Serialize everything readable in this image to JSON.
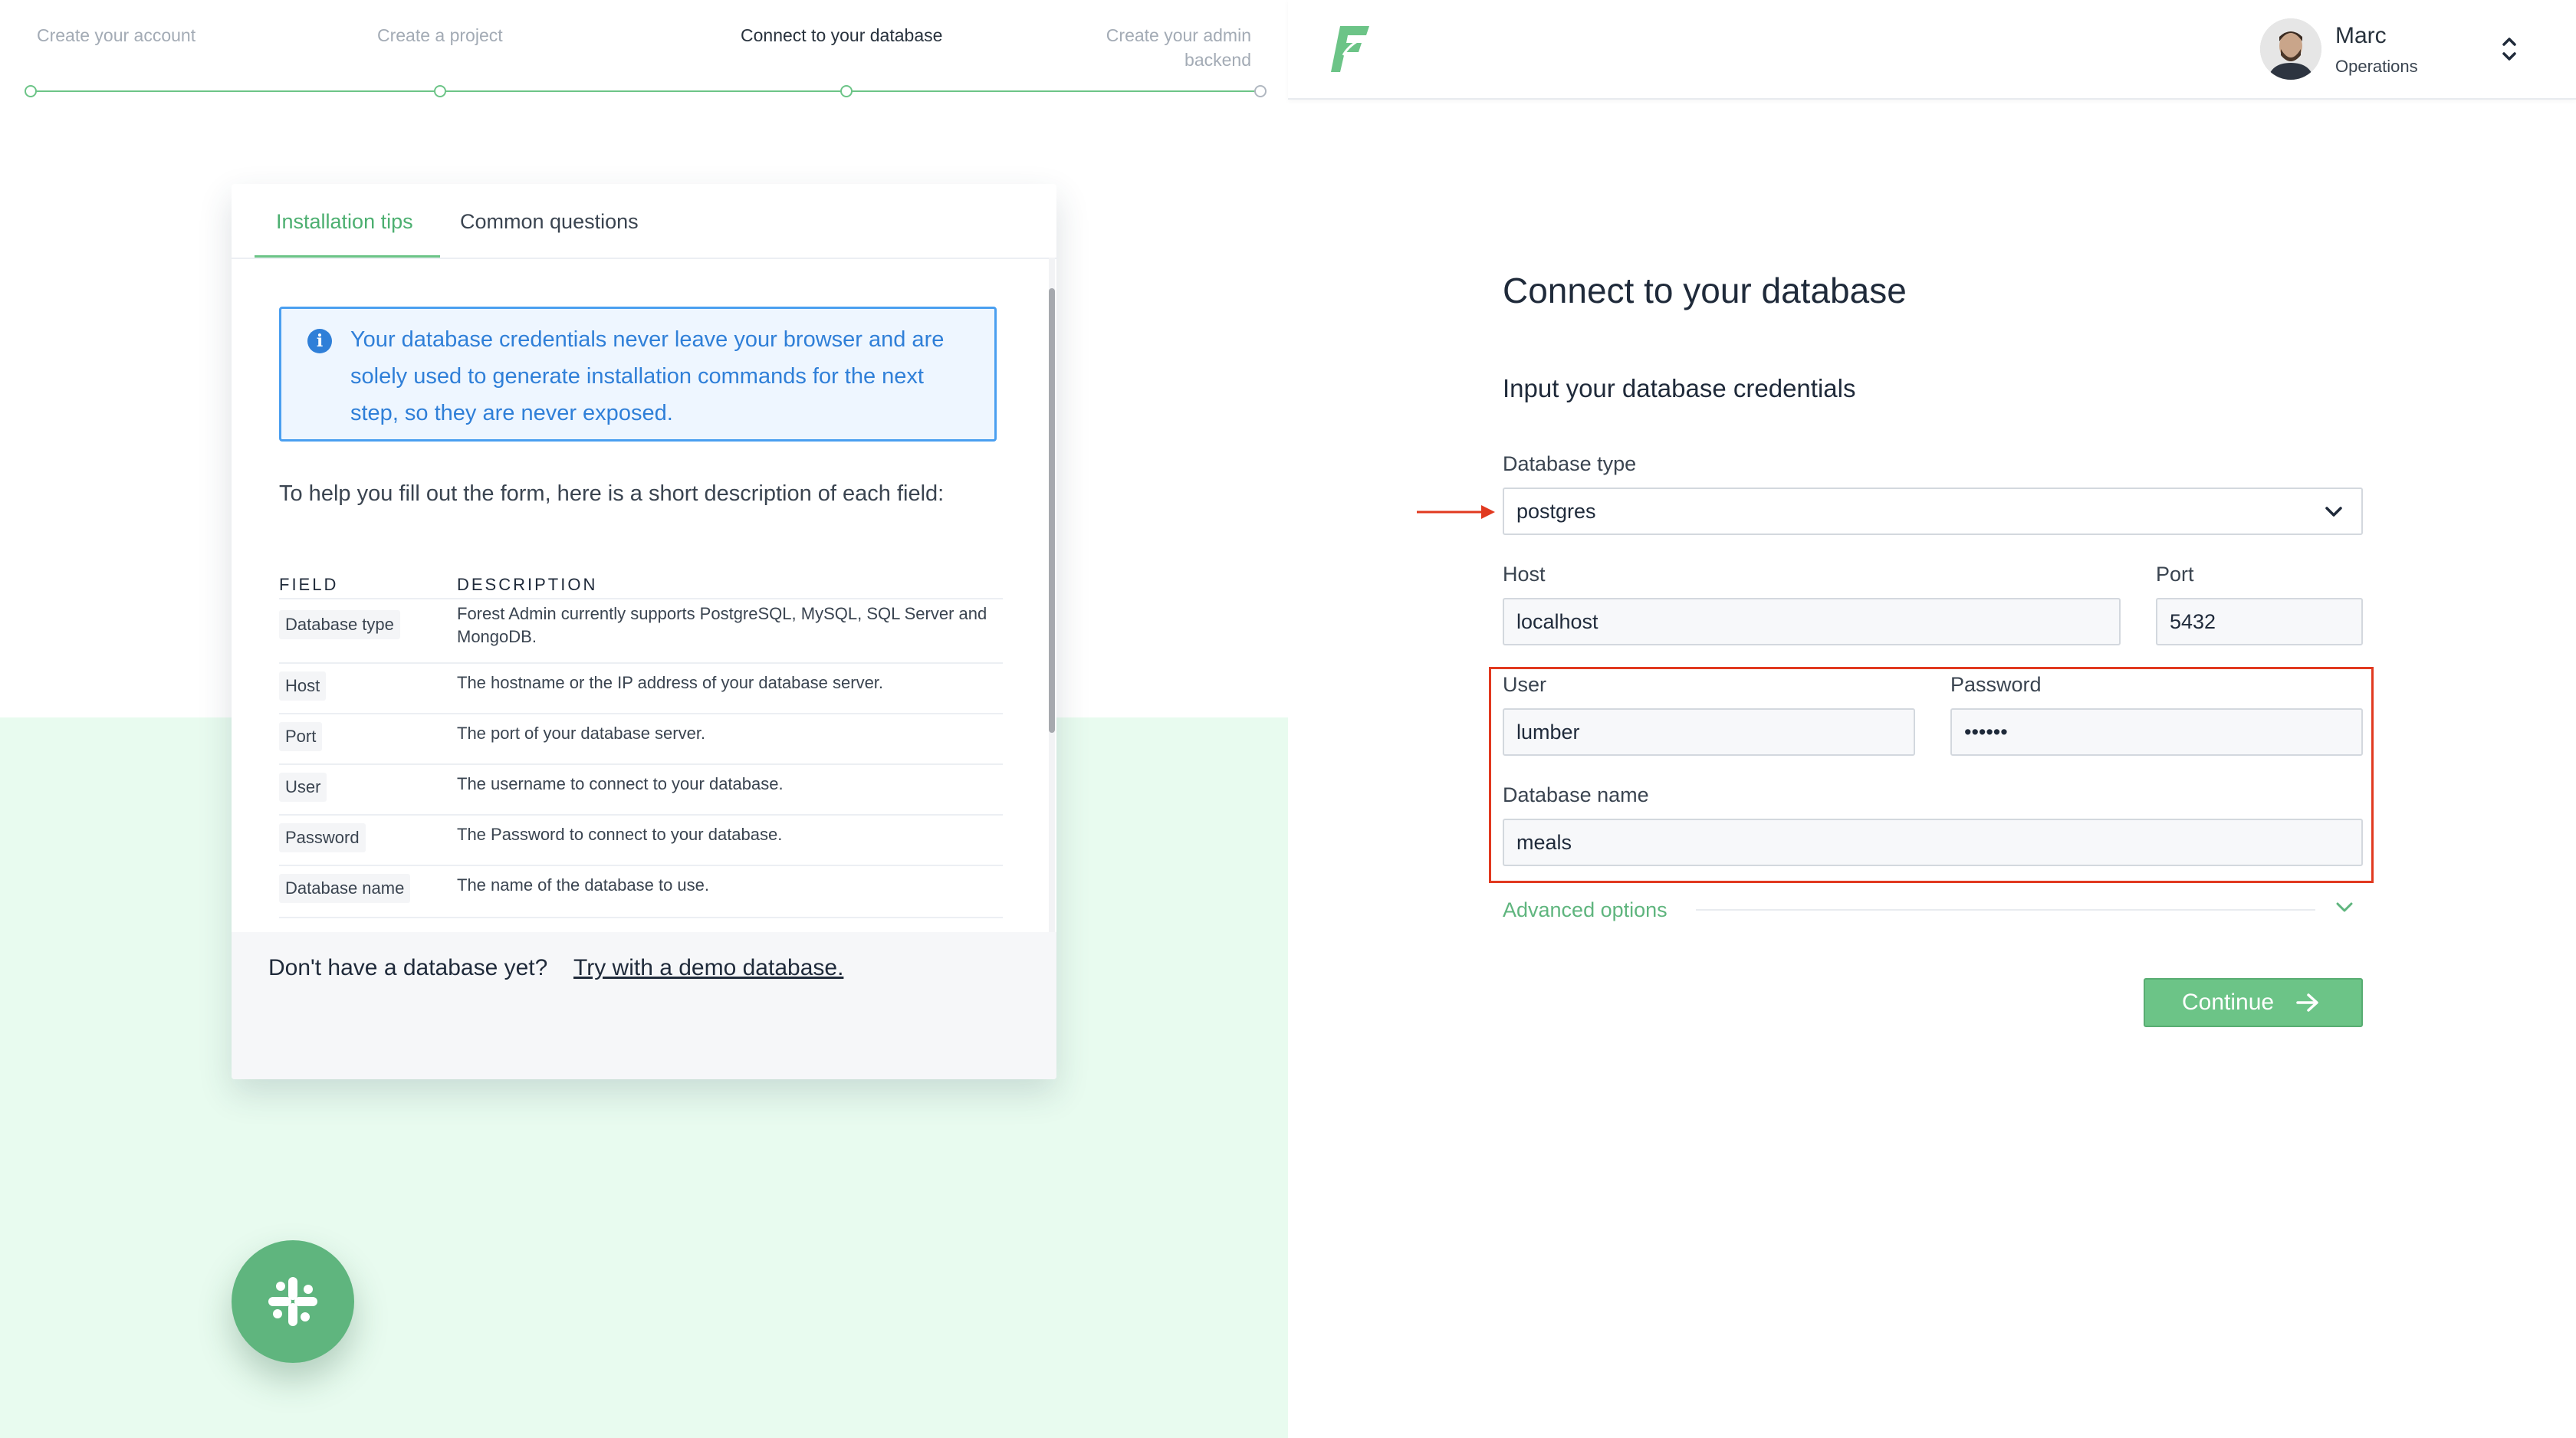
{
  "steps": [
    {
      "label": "Create your account"
    },
    {
      "label": "Create a project"
    },
    {
      "label": "Connect to your database"
    },
    {
      "label": "Create your admin backend"
    }
  ],
  "tips_panel": {
    "tabs": [
      {
        "label": "Installation tips"
      },
      {
        "label": "Common questions"
      }
    ],
    "active_tab": "Installation tips",
    "info_message": "Your database credentials never leave your browser and are solely used to generate installation commands for the next step, so they are never exposed.",
    "help_text": "To help you fill out the form, here is a short description of each field:",
    "table": {
      "headers": [
        "FIELD",
        "DESCRIPTION"
      ],
      "rows": [
        {
          "field": "Database type",
          "description": "Forest Admin currently supports PostgreSQL, MySQL, SQL Server and MongoDB."
        },
        {
          "field": "Host",
          "description": "The hostname or the IP address of your database server."
        },
        {
          "field": "Port",
          "description": "The port of your database server."
        },
        {
          "field": "User",
          "description": "The username to connect to your database."
        },
        {
          "field": "Password",
          "description": "The Password to connect to your database."
        },
        {
          "field": "Database name",
          "description": "The name of the database to use."
        }
      ]
    },
    "demo": {
      "text": "Don't have a database yet?",
      "link": "Try with a demo database."
    }
  },
  "header": {
    "logo_letter": "F",
    "user": {
      "name": "Marc",
      "role": "Operations"
    }
  },
  "form": {
    "title": "Connect to your database",
    "section": "Input your database credentials",
    "database_type": {
      "label": "Database type",
      "value": "postgres"
    },
    "host": {
      "label": "Host",
      "value": "localhost"
    },
    "port": {
      "label": "Port",
      "value": "5432"
    },
    "user": {
      "label": "User",
      "value": "lumber"
    },
    "password": {
      "label": "Password",
      "value": "••••••"
    },
    "database_name": {
      "label": "Database name",
      "value": "meals"
    },
    "advanced_options": "Advanced options",
    "continue": "Continue"
  },
  "colors": {
    "brand_green": "#6cc487",
    "info_blue": "#2f7fd8",
    "highlight_red": "#e1391f",
    "mint_background": "#e8fbef"
  }
}
